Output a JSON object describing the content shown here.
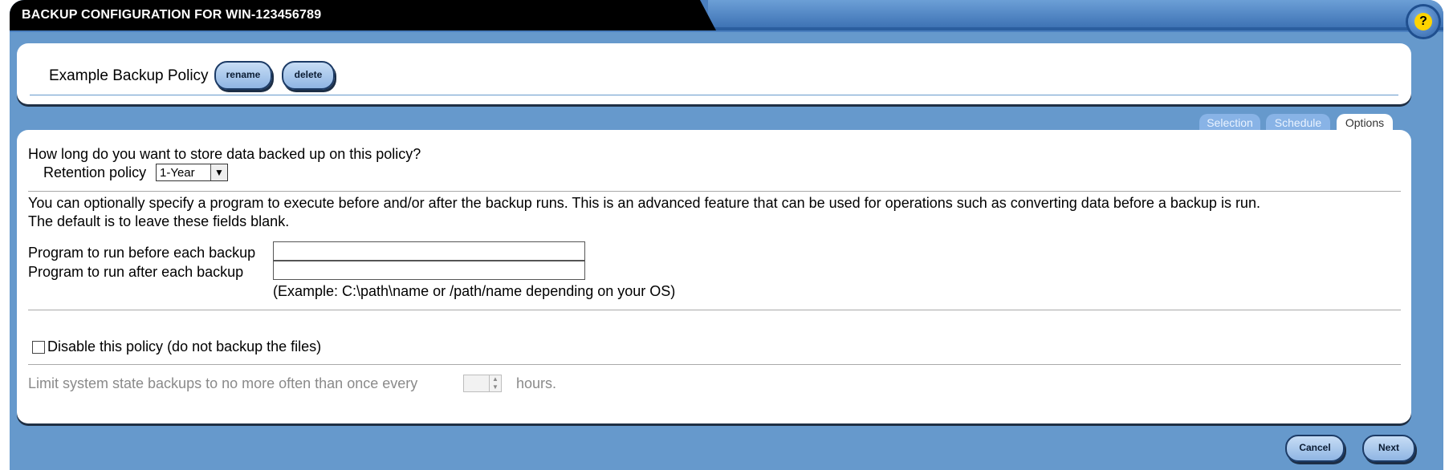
{
  "window": {
    "title": "BACKUP CONFIGURATION FOR WIN-123456789",
    "help_label": "?"
  },
  "policy": {
    "name": "Example Backup Policy",
    "rename_label": "rename",
    "delete_label": "delete"
  },
  "tabs": [
    {
      "label": "Selection",
      "active": false
    },
    {
      "label": "Schedule",
      "active": false
    },
    {
      "label": "Options",
      "active": true
    }
  ],
  "options": {
    "retention_question": "How long do you want to store data backed up on this policy?",
    "retention_label": "Retention policy",
    "retention_value": "1-Year",
    "program_intro_line1": "You can optionally specify a program to execute before and/or after the backup runs. This is an advanced feature that can be used for operations such as converting data before a backup is run.",
    "program_intro_line2": "The default is to leave these fields blank.",
    "before_label": "Program to run before each backup",
    "after_label": "Program to run after each backup",
    "before_value": "",
    "after_value": "",
    "example_text": "(Example: C:\\path\\name or /path/name depending on your OS)",
    "disable_label": "Disable this policy (do not backup the files)",
    "disable_checked": false,
    "limit_prefix": "Limit system state backups to no more often than once every",
    "limit_value": "",
    "limit_suffix": "hours."
  },
  "footer": {
    "cancel_label": "Cancel",
    "next_label": "Next"
  },
  "colors": {
    "frame_blue": "#6699cc",
    "title_black": "#000000",
    "button_blue": "#8fb5e3"
  }
}
